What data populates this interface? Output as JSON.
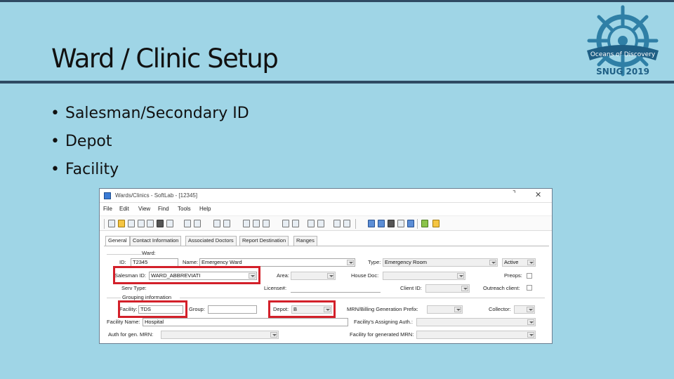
{
  "slide": {
    "title": "Ward / Clinic Setup",
    "bullets": [
      "Salesman/Secondary ID",
      "Depot",
      "Facility"
    ]
  },
  "logo": {
    "banner": "Oceans of Discovery",
    "text": "SNUG 2019",
    "colors": {
      "primary": "#2f7fa6",
      "banner": "#1f5f85"
    }
  },
  "window": {
    "title": "Wards/Clinics - SoftLab - [12345]",
    "menu": [
      "File",
      "Edit",
      "View",
      "Find",
      "Tools",
      "Help"
    ],
    "tabs": [
      "General",
      "Contact Information",
      "Associated Doctors",
      "Report Destination",
      "Ranges"
    ],
    "form": {
      "ward_label": "Ward:",
      "id_label": "ID:",
      "id_value": "T2345",
      "name_label": "Name:",
      "name_value": "Emergency Ward",
      "type_label": "Type:",
      "type_value": "Emergency Room",
      "status_value": "Active",
      "salesman_label": "Salesman ID:",
      "salesman_value": "WARD_ABBREVIATI",
      "area_label": "Area:",
      "house_doc_label": "House Doc:",
      "preops_label": "Preops:",
      "serv_type_label": "Serv Type:",
      "license_label": "License#:",
      "client_id_label": "Client ID:",
      "outreach_label": "Outreach client:",
      "grouping_label": "Grouping information",
      "facility_label": "Facility:",
      "facility_value": "TDS",
      "group_label": "Group:",
      "depot_label": "Depot:",
      "depot_value": "B",
      "mrn_label": "MRN/Billing Generation Prefix:",
      "collector_label": "Collector:",
      "facility_name_label": "Facility Name:",
      "facility_name_value": "Hospital",
      "facility_assign_label": "Facility's Assigning Auth.:",
      "auth_gen_label": "Auth for gen. MRN:",
      "facility_gen_label": "Facility for generated MRN:"
    },
    "highlight_color": "#d3202a"
  }
}
